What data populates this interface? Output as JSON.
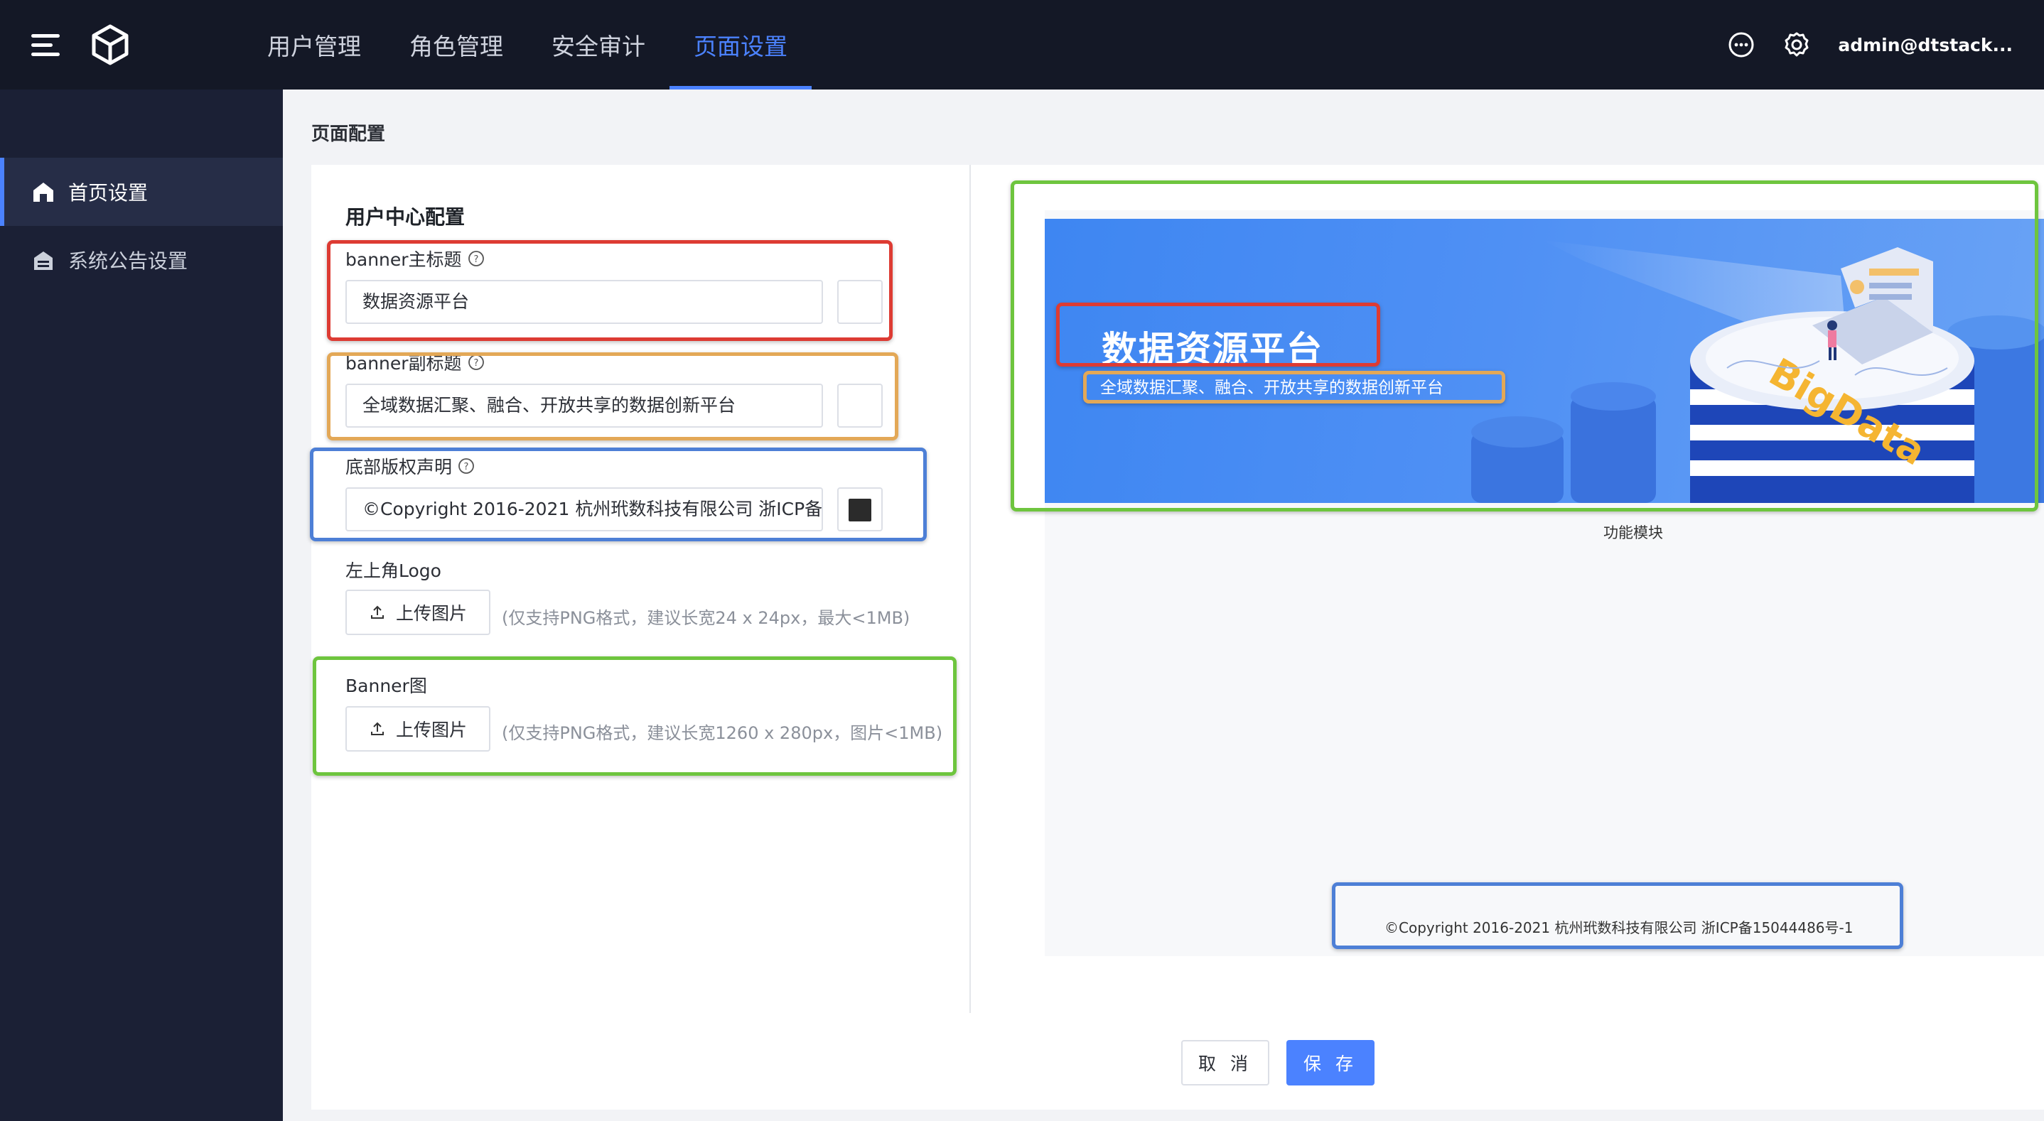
{
  "header": {
    "nav": [
      "用户管理",
      "角色管理",
      "安全审计",
      "页面设置"
    ],
    "active_nav_index": 3,
    "user": "admin@dtstack..."
  },
  "sidebar": {
    "items": [
      {
        "label": "首页设置",
        "icon": "home-icon",
        "active": true
      },
      {
        "label": "系统公告设置",
        "icon": "announcement-icon",
        "active": false
      }
    ]
  },
  "page": {
    "title": "页面配置",
    "section_title": "用户中心配置"
  },
  "form": {
    "banner_title": {
      "label": "banner主标题",
      "value": "数据资源平台",
      "color": "#ffffff"
    },
    "banner_subtitle": {
      "label": "banner副标题",
      "value": "全域数据汇聚、融合、开放共享的数据创新平台",
      "color": "#ffffff"
    },
    "footer_copyright": {
      "label": "底部版权声明",
      "value": "©Copyright 2016-2021 杭州玳数科技有限公司 浙ICP备1",
      "color": "#2b2b2b"
    },
    "logo": {
      "label": "左上角Logo",
      "upload_label": "上传图片",
      "hint": "(仅支持PNG格式，建议长宽24 x 24px，最大<1MB)"
    },
    "banner_image": {
      "label": "Banner图",
      "upload_label": "上传图片",
      "hint": "(仅支持PNG格式，建议长宽1260 x 280px，图片<1MB)"
    }
  },
  "preview": {
    "banner_title": "数据资源平台",
    "banner_subtitle": "全域数据汇聚、融合、开放共享的数据创新平台",
    "module_label": "功能模块",
    "copyright": "©Copyright 2016-2021 杭州玳数科技有限公司 浙ICP备15044486号-1",
    "illustration_text": "BigData"
  },
  "actions": {
    "cancel": "取 消",
    "save": "保 存"
  },
  "colors": {
    "accent": "#4b82ff",
    "topbar": "#141826",
    "sidebar": "#1b2035",
    "highlight_red": "#dd3b33",
    "highlight_orange": "#e3a857",
    "highlight_blue": "#4d7fd6",
    "highlight_green": "#6ec53e"
  }
}
